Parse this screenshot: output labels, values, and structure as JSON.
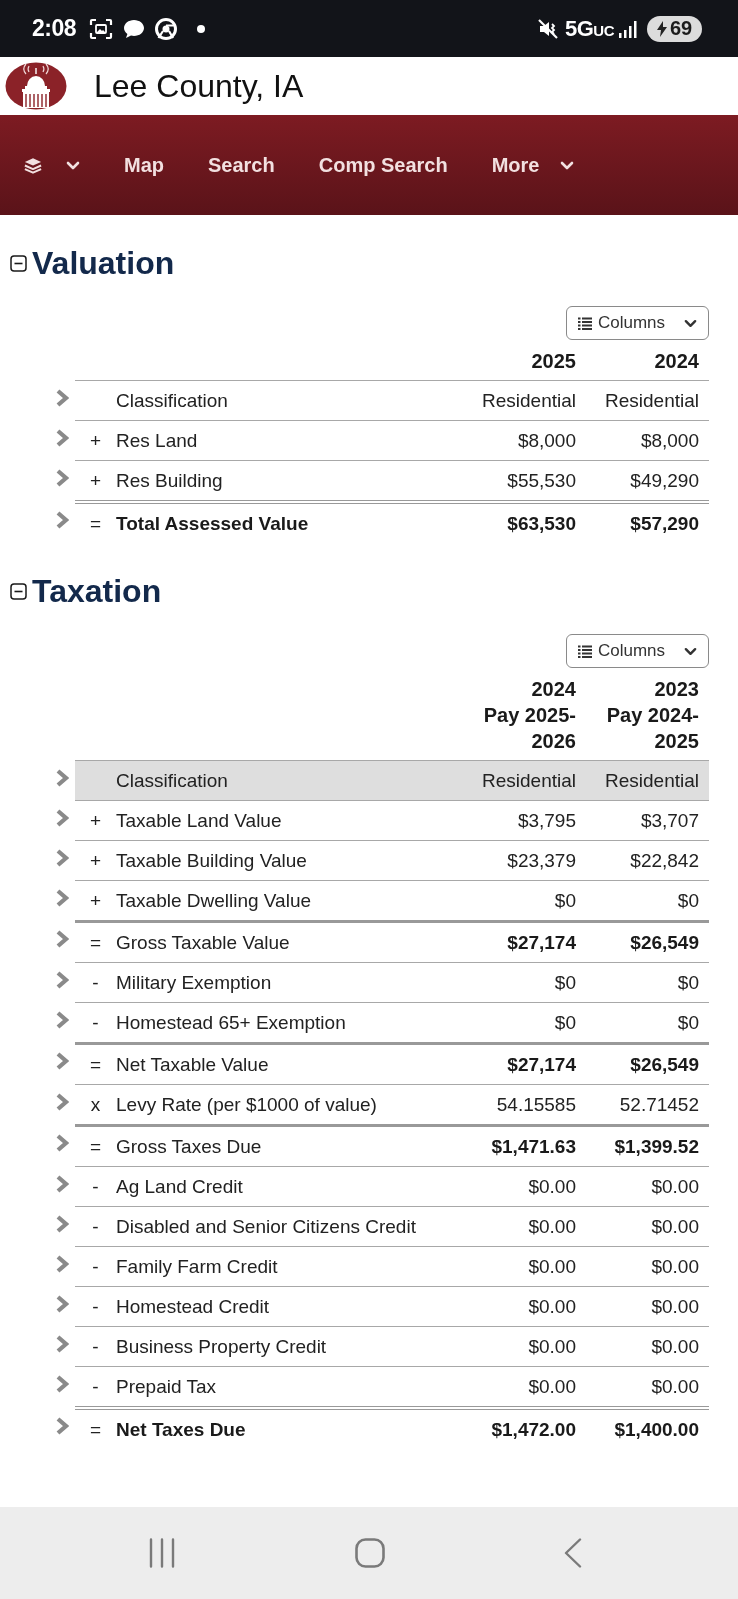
{
  "status_bar": {
    "time": "2:08",
    "network": "5G$_{UC}$",
    "battery": "69",
    "charging": true
  },
  "header": {
    "title": "Lee County, IA"
  },
  "nav": {
    "items": [
      {
        "kind": "icon",
        "dropdown": true
      },
      {
        "kind": "link",
        "label": "Map",
        "dropdown": false
      },
      {
        "kind": "link",
        "label": "Search",
        "dropdown": false
      },
      {
        "kind": "link",
        "label": "Comp Search",
        "dropdown": false
      },
      {
        "kind": "link",
        "label": "More",
        "dropdown": true
      }
    ]
  },
  "sections": [
    {
      "title": "Valuation",
      "expanded": true,
      "columns_button": {
        "label": "Columns"
      },
      "columns": [
        {
          "heading_lines": [
            "2025"
          ]
        },
        {
          "heading_lines": [
            "2024"
          ]
        }
      ],
      "classification": {
        "label": "Classification",
        "values": [
          "Residential",
          "Residential"
        ],
        "highlighted": false
      },
      "rows": [
        {
          "kind": "item",
          "operator": "+",
          "label": "Res Land",
          "values": [
            "$8,000",
            "$8,000"
          ]
        },
        {
          "kind": "item",
          "operator": "+",
          "label": "Res Building",
          "values": [
            "$55,530",
            "$49,290"
          ]
        },
        {
          "kind": "total",
          "operator": "=",
          "label": "Total Assessed Value",
          "values": [
            "$63,530",
            "$57,290"
          ]
        }
      ]
    },
    {
      "title": "Taxation",
      "expanded": true,
      "columns_button": {
        "label": "Columns"
      },
      "columns": [
        {
          "heading_lines": [
            "2024",
            "Pay 2025-",
            "2026"
          ]
        },
        {
          "heading_lines": [
            "2023",
            "Pay 2024-",
            "2025"
          ]
        }
      ],
      "classification": {
        "label": "Classification",
        "values": [
          "Residential",
          "Residential"
        ],
        "highlighted": true
      },
      "rows": [
        {
          "kind": "item",
          "operator": "+",
          "label": "Taxable Land Value",
          "values": [
            "$3,795",
            "$3,707"
          ]
        },
        {
          "kind": "item",
          "operator": "+",
          "label": "Taxable Building Value",
          "values": [
            "$23,379",
            "$22,842"
          ]
        },
        {
          "kind": "item",
          "operator": "+",
          "label": "Taxable Dwelling Value",
          "values": [
            "$0",
            "$0"
          ]
        },
        {
          "kind": "subtotal",
          "operator": "=",
          "label": "Gross Taxable Value",
          "values": [
            "$27,174",
            "$26,549"
          ]
        },
        {
          "kind": "item",
          "operator": "-",
          "label": "Military Exemption",
          "values": [
            "$0",
            "$0"
          ]
        },
        {
          "kind": "item",
          "operator": "-",
          "label": "Homestead 65+ Exemption",
          "values": [
            "$0",
            "$0"
          ]
        },
        {
          "kind": "subtotal",
          "operator": "=",
          "label": "Net Taxable Value",
          "values": [
            "$27,174",
            "$26,549"
          ]
        },
        {
          "kind": "item",
          "operator": "x",
          "label": "Levy Rate (per $1000 of value)",
          "values": [
            "54.15585",
            "52.71452"
          ]
        },
        {
          "kind": "subtotal",
          "operator": "=",
          "label": "Gross Taxes Due",
          "values": [
            "$1,471.63",
            "$1,399.52"
          ]
        },
        {
          "kind": "item",
          "operator": "-",
          "label": "Ag Land Credit",
          "values": [
            "$0.00",
            "$0.00"
          ]
        },
        {
          "kind": "item",
          "operator": "-",
          "label": "Disabled and Senior Citizens Credit",
          "values": [
            "$0.00",
            "$0.00"
          ]
        },
        {
          "kind": "item",
          "operator": "-",
          "label": "Family Farm Credit",
          "values": [
            "$0.00",
            "$0.00"
          ]
        },
        {
          "kind": "item",
          "operator": "-",
          "label": "Homestead Credit",
          "values": [
            "$0.00",
            "$0.00"
          ]
        },
        {
          "kind": "item",
          "operator": "-",
          "label": "Business Property Credit",
          "values": [
            "$0.00",
            "$0.00"
          ]
        },
        {
          "kind": "item",
          "operator": "-",
          "label": "Prepaid Tax",
          "values": [
            "$0.00",
            "$0.00"
          ]
        },
        {
          "kind": "total",
          "operator": "=",
          "label": "Net Taxes Due",
          "values": [
            "$1,472.00",
            "$1,400.00"
          ]
        }
      ]
    }
  ]
}
